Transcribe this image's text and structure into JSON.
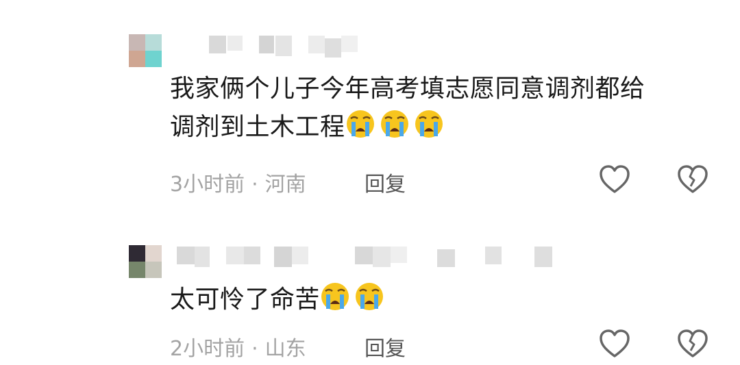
{
  "comments": [
    {
      "text_line1": "我家俩个儿子今年高考填志愿同意调剂都给",
      "text_line2": "调剂到土木工程",
      "emoji_count": 3,
      "time": "3小时前",
      "dot": "·",
      "location": "河南",
      "reply_label": "回复",
      "emoji_icon": "loudly-crying-face-icon"
    },
    {
      "text_line1": "太可怜了命苦",
      "emoji_count": 2,
      "time": "2小时前",
      "dot": "·",
      "location": "山东",
      "reply_label": "回复",
      "emoji_icon": "loudly-crying-face-icon"
    }
  ],
  "icons": {
    "like": "heart-outline-icon",
    "dislike": "broken-heart-icon"
  },
  "colors": {
    "text": "#1a1a1a",
    "meta": "#a3a3a3",
    "reply": "#555555",
    "icon": "#666666"
  }
}
